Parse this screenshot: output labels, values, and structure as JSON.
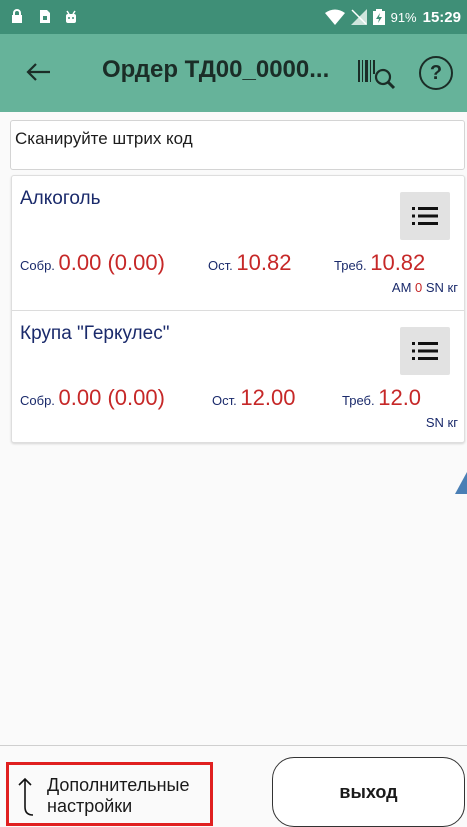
{
  "status_bar": {
    "battery_percent": "91%",
    "time": "15:29",
    "icons": [
      "lock-icon",
      "sim-icon",
      "android-icon",
      "wifi-icon",
      "no-signal-icon",
      "battery-charging-icon"
    ]
  },
  "app_bar": {
    "title": "Ордер ТД00_0000...",
    "icons": [
      "back-arrow-icon",
      "barcode-search-icon",
      "help-icon"
    ],
    "help_label": "?"
  },
  "scan": {
    "label": "Сканируйте штрих код"
  },
  "items": [
    {
      "name": "Алкоголь",
      "collected_label": "Собр.",
      "collected_value": "0.00 (0.00)",
      "remaining_label": "Ост.",
      "remaining_value": "10.82",
      "required_label": "Треб.",
      "required_value": "10.82",
      "am_label": "АМ",
      "am_value": "0",
      "units": "SN кг"
    },
    {
      "name": "Крупа \"Геркулес\"",
      "collected_label": "Собр.",
      "collected_value": "0.00 (0.00)",
      "remaining_label": "Ост.",
      "remaining_value": "12.00",
      "required_label": "Треб.",
      "required_value": "12.0",
      "units": "SN кг"
    }
  ],
  "bottom": {
    "more_settings_line1": "Дополнительные",
    "more_settings_line2": "настройки",
    "exit_label": "выход"
  },
  "colors": {
    "status_bar": "#3f8f77",
    "app_bar": "#66b39a",
    "value_red": "#c62828",
    "label_blue": "#1a2a6b",
    "highlight_red": "#e02020"
  }
}
